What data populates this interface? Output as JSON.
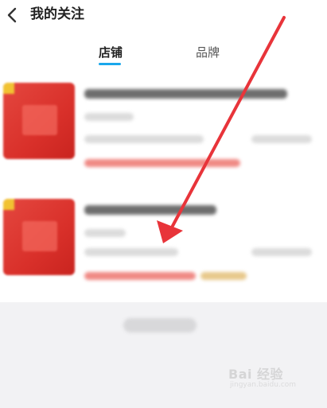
{
  "header": {
    "title": "我的关注",
    "back_icon": "chevron-left-icon"
  },
  "tabs": [
    {
      "label": "店铺",
      "active": true
    },
    {
      "label": "品牌",
      "active": false
    }
  ],
  "colors": {
    "accent": "#1aa7ec",
    "thumb_red": "#d9302a",
    "arrow_red": "#e8343a",
    "background": "#f2f2f4"
  },
  "watermark": {
    "text": "Bai 经验",
    "url_text": "jingyan.baidu.com"
  }
}
